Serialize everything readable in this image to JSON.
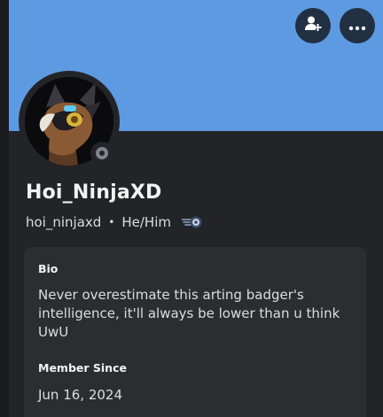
{
  "profile": {
    "display_name": "Hoi_NinjaXD",
    "username": "hoi_ninjaxd",
    "separator": "•",
    "pronouns": "He/Him",
    "status": "offline",
    "banner_color": "#5e9ae2"
  },
  "actions": {
    "add_friend_icon": "add-friend-icon",
    "more_icon": "more-options-icon"
  },
  "about": {
    "bio_label": "Bio",
    "bio_text": "Never overestimate this arting badger's intelligence, it'll always be lower than u think UwU",
    "member_since_label": "Member Since",
    "member_since_value": "Jun 16, 2024"
  }
}
